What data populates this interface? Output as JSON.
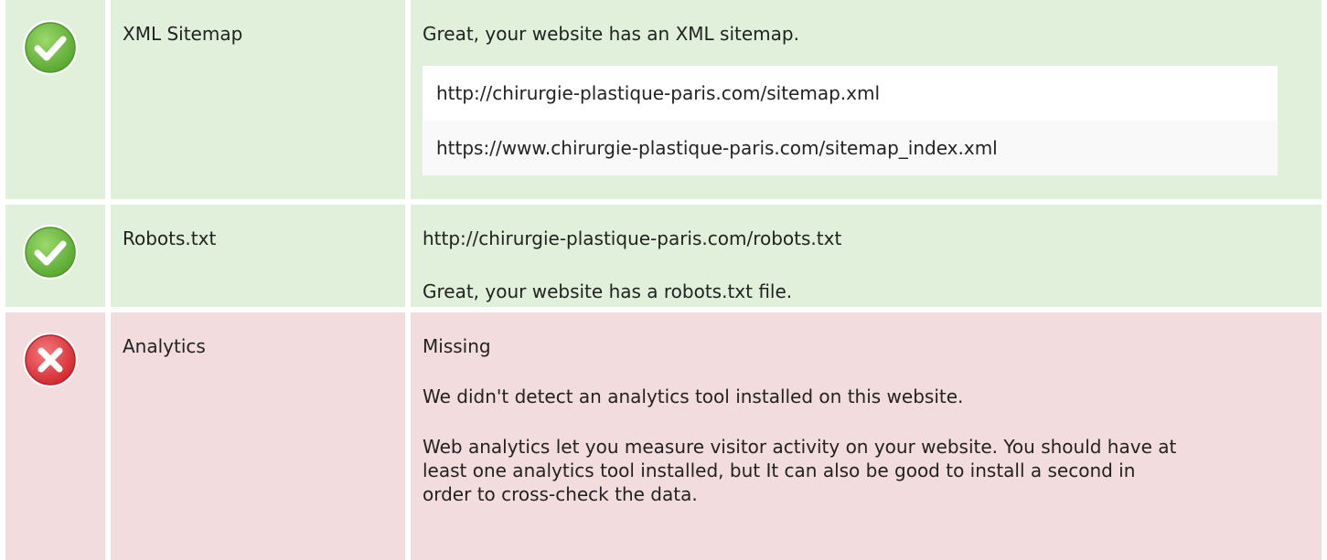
{
  "rows": [
    {
      "status": "pass",
      "icon": "check-icon",
      "label": "XML Sitemap",
      "message": "Great, your website has an XML sitemap.",
      "urls": [
        "http://chirurgie-plastique-paris.com/sitemap.xml",
        "https://www.chirurgie-plastique-paris.com/sitemap_index.xml"
      ]
    },
    {
      "status": "pass",
      "icon": "check-icon",
      "label": "Robots.txt",
      "url": "http://chirurgie-plastique-paris.com/robots.txt",
      "message": "Great, your website has a robots.txt file."
    },
    {
      "status": "fail",
      "icon": "cross-icon",
      "label": "Analytics",
      "state": "Missing",
      "message": "We didn't detect an analytics tool installed on this website.",
      "description": "Web analytics let you measure visitor activity on your website. You should have at least one analytics tool installed, but It can also be good to install a second in order to cross-check the data."
    }
  ],
  "colors": {
    "pass_bg": "#e0f0da",
    "fail_bg": "#f3dcdd",
    "pass_icon": "#6dbe45",
    "fail_icon": "#e0393e"
  }
}
